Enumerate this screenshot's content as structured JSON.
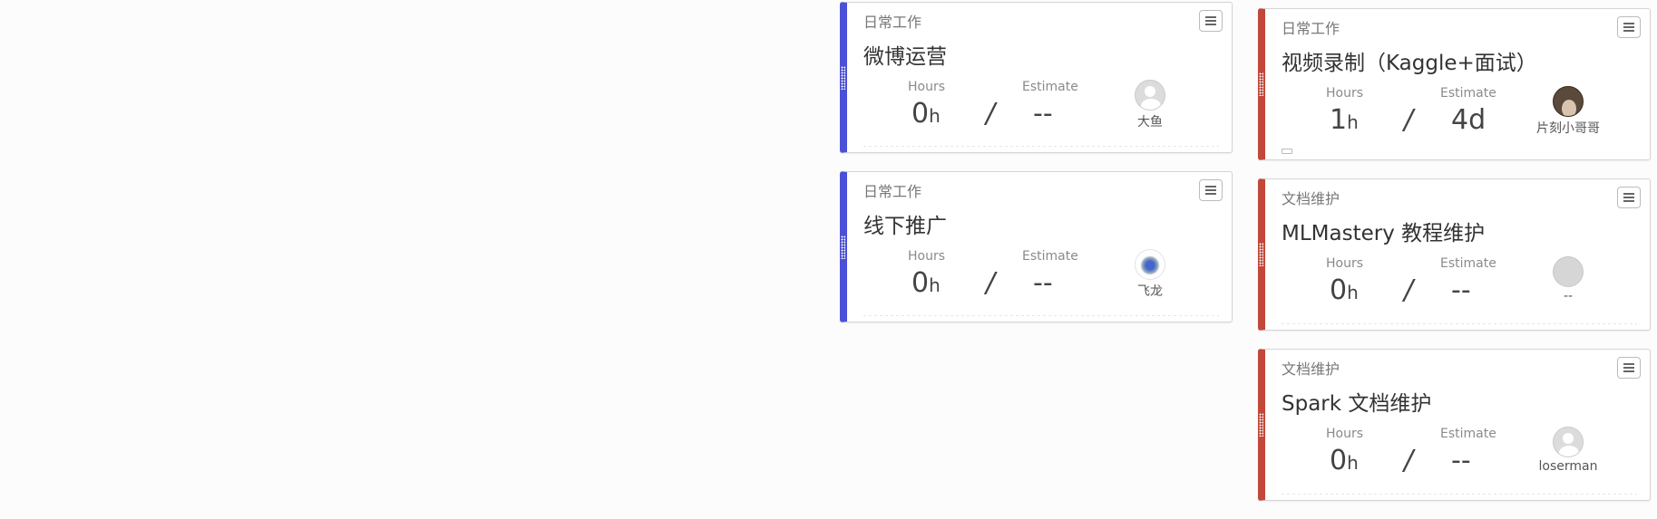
{
  "labels": {
    "hours": "Hours",
    "estimate": "Estimate",
    "hours_unit": "h",
    "slash": "/"
  },
  "colors": {
    "column1_accent": "#4b50d8",
    "column2_accent": "#c3473a"
  },
  "columns": [
    {
      "cards": [
        {
          "category": "日常工作",
          "title": "微博运营",
          "hours": "0",
          "estimate": "--",
          "assignee": "大鱼",
          "avatar_icon": "default-avatar-icon"
        },
        {
          "category": "日常工作",
          "title": "线下推广",
          "hours": "0",
          "estimate": "--",
          "assignee": "飞龙",
          "avatar_icon": "photo-avatar-icon"
        }
      ]
    },
    {
      "cards": [
        {
          "category": "日常工作",
          "title": "视频录制（Kaggle+面试）",
          "hours": "1",
          "estimate": "4d",
          "assignee": "片刻小哥哥",
          "avatar_icon": "photo-avatar-icon"
        },
        {
          "category": "文档维护",
          "title": "MLMastery 教程维护",
          "hours": "0",
          "estimate": "--",
          "assignee": "--",
          "avatar_icon": "blank-avatar-icon"
        },
        {
          "category": "文档维护",
          "title": "Spark 文档维护",
          "hours": "0",
          "estimate": "--",
          "assignee": "loserman",
          "avatar_icon": "default-avatar-icon"
        }
      ]
    }
  ]
}
